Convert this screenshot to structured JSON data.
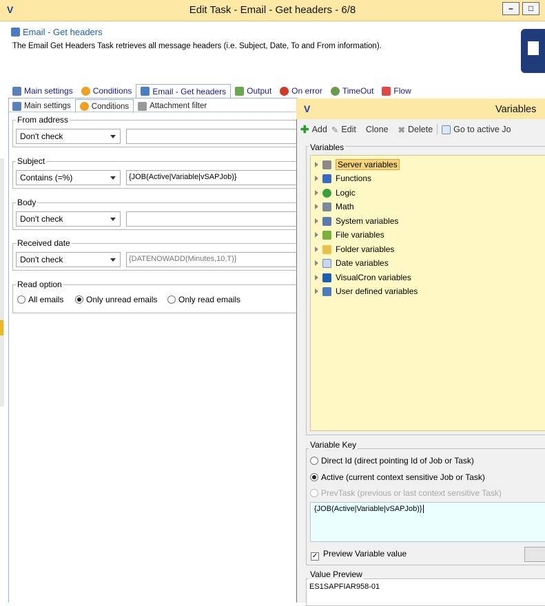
{
  "window": {
    "title": "Edit Task - Email - Get headers - 6/8",
    "logo": "V"
  },
  "header": {
    "title": "Email - Get headers",
    "description": "The Email Get Headers Task retrieves all message headers (i.e. Subject, Date, To and From information)."
  },
  "tabs": [
    {
      "label": "Main settings",
      "icon": "gear-icon"
    },
    {
      "label": "Conditions",
      "icon": "question-icon"
    },
    {
      "label": "Email - Get headers",
      "icon": "email-icon"
    },
    {
      "label": "Output",
      "icon": "output-icon"
    },
    {
      "label": "On error",
      "icon": "error-icon"
    },
    {
      "label": "TimeOut",
      "icon": "timeout-icon"
    },
    {
      "label": "Flow",
      "icon": "flow-icon"
    }
  ],
  "subtabs": [
    {
      "label": "Main settings",
      "icon": "gear-icon"
    },
    {
      "label": "Conditions",
      "icon": "question-icon"
    },
    {
      "label": "Attachment filter",
      "icon": "paperclip-icon"
    }
  ],
  "conditions": {
    "from": {
      "label": "From address",
      "mode": "Don't check",
      "value": ""
    },
    "subject": {
      "label": "Subject",
      "mode": "Contains (=%)",
      "value": "{JOB(Active|Variable|vSAPJob)}"
    },
    "body": {
      "label": "Body",
      "mode": "Don't check",
      "value": ""
    },
    "received": {
      "label": "Received date",
      "mode": "Don't check",
      "value": "{DATENOWADD(Minutes,10,T)}"
    },
    "read": {
      "label": "Read option",
      "options": [
        "All emails",
        "Only unread emails",
        "Only read emails"
      ],
      "selected": "Only unread emails"
    }
  },
  "variables_window": {
    "title": "Variables",
    "toolbar": {
      "add": "Add",
      "edit": "Edit",
      "clone": "Clone",
      "delete": "Delete",
      "goto": "Go to active Jo"
    },
    "group_label": "Variables",
    "tree": [
      "Server variables",
      "Functions",
      "Logic",
      "Math",
      "System variables",
      "File variables",
      "Folder variables",
      "Date variables",
      "VisualCron variables",
      "User defined variables"
    ],
    "selected": "Server variables",
    "key_label": "Variable Key",
    "key_options": [
      "Direct Id (direct pointing Id of Job or Task)",
      "Active (current context sensitive Job or Task)",
      "PrevTask (previous or last context sensitive Task)"
    ],
    "key_selected": "Active (current context sensitive Job or Task)",
    "expression": "{JOB(Active|Variable|vSAPJob)}",
    "preview_checkbox": "Preview Variable value",
    "preview_label": "Value Preview",
    "preview_value": "ES1SAPFIAR958-01"
  }
}
